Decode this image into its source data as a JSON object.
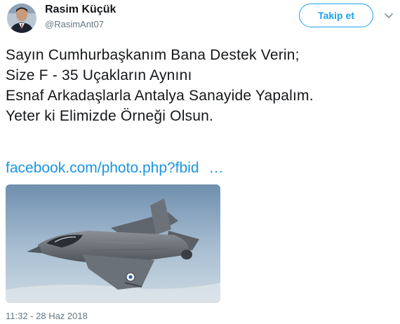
{
  "author": {
    "name": "Rasim Küçük",
    "handle": "@RasimAnt07"
  },
  "follow_button_label": "Takip et",
  "tweet_lines": [
    "Sayın Cumhurbaşkanım Bana Destek Verin;",
    "Size F - 35 Uçakların Aynını",
    "Esnaf Arkadaşlarla Antalya Sanayide Yapalım.",
    "Yeter ki Elimizde Örneği Olsun."
  ],
  "link": {
    "text": "facebook.com/photo.php?fbid",
    "ellipsis": "…"
  },
  "timestamp": "11:32 - 28 Haz 2018",
  "colors": {
    "accent": "#1da1f2",
    "link": "#1b95e0",
    "muted": "#657786",
    "text": "#14171a"
  },
  "icons": [
    "caret-down-icon"
  ]
}
